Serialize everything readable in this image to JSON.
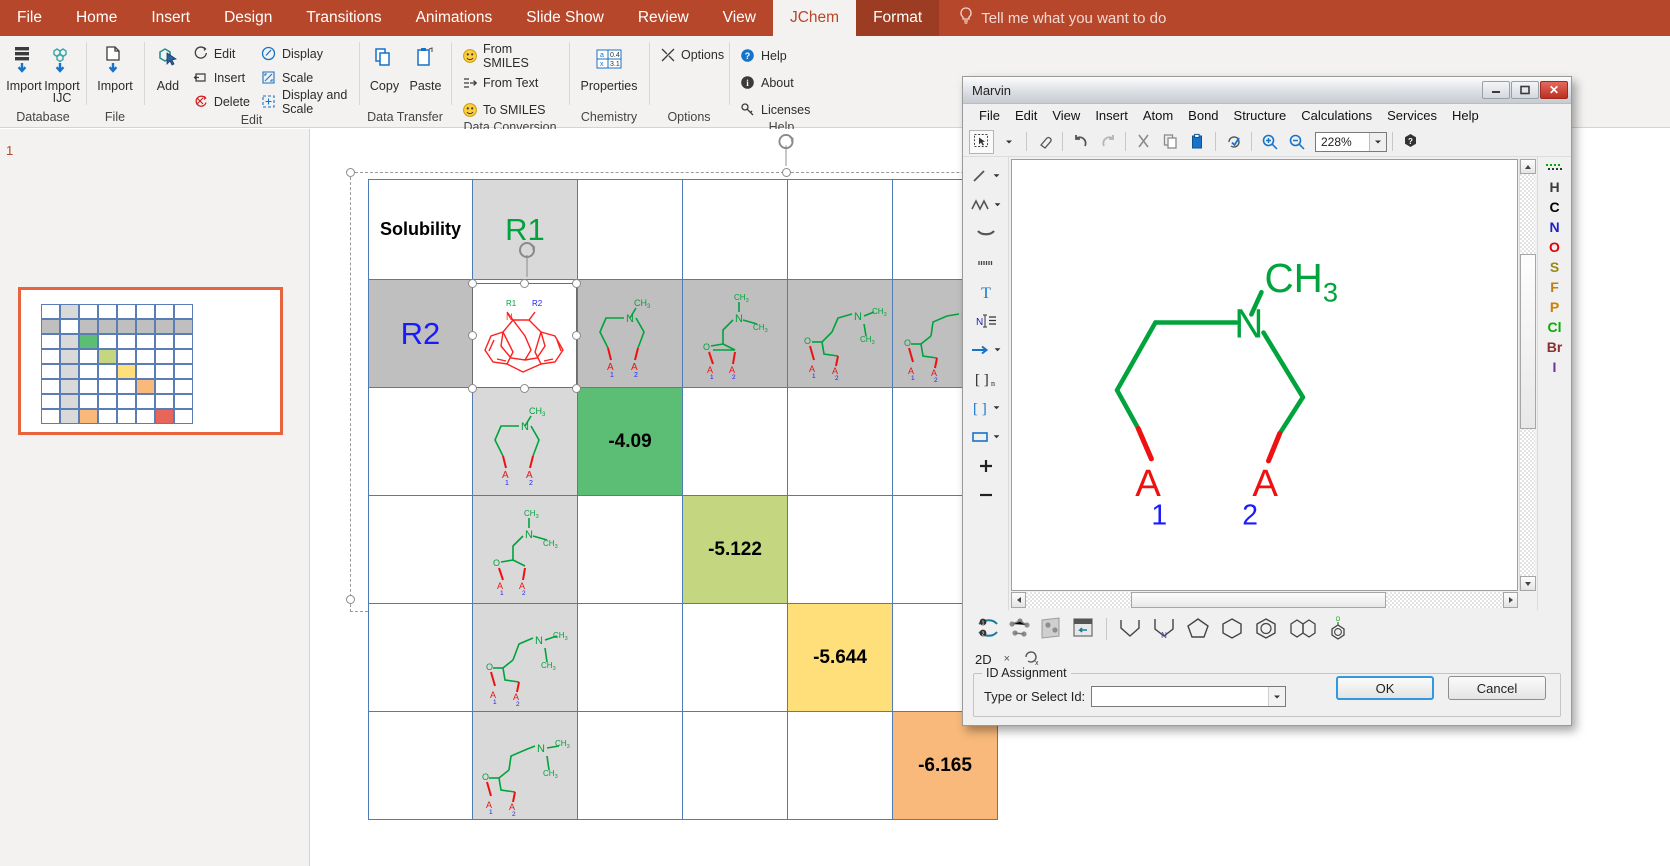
{
  "ribbon": {
    "tabs": [
      {
        "label": "File",
        "state": "normal"
      },
      {
        "label": "Home",
        "state": "normal"
      },
      {
        "label": "Insert",
        "state": "normal"
      },
      {
        "label": "Design",
        "state": "normal"
      },
      {
        "label": "Transitions",
        "state": "normal"
      },
      {
        "label": "Animations",
        "state": "normal"
      },
      {
        "label": "Slide Show",
        "state": "normal"
      },
      {
        "label": "Review",
        "state": "normal"
      },
      {
        "label": "View",
        "state": "normal"
      },
      {
        "label": "JChem",
        "state": "active"
      },
      {
        "label": "Format",
        "state": "context"
      }
    ],
    "tell_me": "Tell me what you want to do",
    "accent_color": "#b7472a",
    "groups": [
      {
        "name": "Database",
        "big_buttons": [
          {
            "label": "Import",
            "icon": "import-database-icon"
          },
          {
            "label": "Import IJC",
            "icon": "import-ijc-icon"
          }
        ],
        "small_buttons": []
      },
      {
        "name": "File",
        "big_buttons": [
          {
            "label": "Import",
            "icon": "import-file-icon"
          }
        ],
        "small_buttons": []
      },
      {
        "name": "Edit",
        "big_buttons": [
          {
            "label": "Add",
            "icon": "add-structure-icon"
          }
        ],
        "small_buttons": [
          {
            "label": "Edit",
            "icon": "edit-icon"
          },
          {
            "label": "Insert",
            "icon": "insert-icon"
          },
          {
            "label": "Delete",
            "icon": "delete-icon"
          },
          {
            "label": "Display",
            "icon": "display-icon"
          },
          {
            "label": "Scale",
            "icon": "scale-icon"
          },
          {
            "label": "Display and Scale",
            "icon": "display-and-scale-icon"
          }
        ]
      },
      {
        "name": "Data Transfer",
        "big_buttons": [
          {
            "label": "Copy",
            "icon": "copy-icon"
          },
          {
            "label": "Paste",
            "icon": "paste-icon"
          }
        ],
        "small_buttons": []
      },
      {
        "name": "Data Conversion",
        "big_buttons": [],
        "small_buttons": [
          {
            "label": "From SMILES",
            "icon": "from-smiles-icon"
          },
          {
            "label": "From Text",
            "icon": "from-text-icon"
          },
          {
            "label": "To SMILES",
            "icon": "to-smiles-icon"
          }
        ]
      },
      {
        "name": "Chemistry",
        "big_buttons": [
          {
            "label": "Properties",
            "icon": "properties-icon"
          }
        ],
        "small_buttons": []
      },
      {
        "name": "Options",
        "big_buttons": [],
        "small_buttons": [
          {
            "label": "Options",
            "icon": "options-icon"
          }
        ]
      },
      {
        "name": "Help",
        "big_buttons": [],
        "small_buttons": [
          {
            "label": "Help",
            "icon": "help-icon"
          },
          {
            "label": "About",
            "icon": "about-icon"
          },
          {
            "label": "Licenses",
            "icon": "licenses-icon"
          }
        ]
      }
    ]
  },
  "slide_panel": {
    "slide_number": "1"
  },
  "table": {
    "header_row": [
      {
        "text": "Solubility",
        "style": "label-solubility",
        "bg": "white"
      },
      {
        "text": "R1",
        "style": "label-r1",
        "bg": "grey-light"
      },
      {
        "text": "",
        "style": "empty",
        "bg": "white"
      },
      {
        "text": "",
        "style": "empty",
        "bg": "white"
      },
      {
        "text": "",
        "style": "empty",
        "bg": "white"
      },
      {
        "text": "",
        "style": "empty",
        "bg": "white"
      }
    ],
    "r2_row": [
      {
        "text": "R2",
        "style": "label-r2",
        "bg": "grey-dark"
      },
      {
        "text": "",
        "style": "scaffold",
        "bg": "white"
      },
      {
        "text": "",
        "style": "rgroup-a",
        "bg": "grey-dark"
      },
      {
        "text": "",
        "style": "rgroup-b",
        "bg": "grey-dark"
      },
      {
        "text": "",
        "style": "rgroup-c",
        "bg": "grey-dark"
      },
      {
        "text": "",
        "style": "rgroup-d",
        "bg": "grey-dark"
      }
    ],
    "data_rows": [
      {
        "rgroup": "rgroup-a",
        "col": 2,
        "value": "-4.09",
        "color": "#5cbd74"
      },
      {
        "rgroup": "rgroup-b",
        "col": 3,
        "value": "-5.122",
        "color": "#c4d780"
      },
      {
        "rgroup": "rgroup-c",
        "col": 4,
        "value": "-5.644",
        "color": "#ffdf7a"
      },
      {
        "rgroup": "rgroup-d",
        "col": 5,
        "value": "-6.165",
        "color": "#f8b97a"
      }
    ],
    "colors": {
      "grid": "#4f7cb5",
      "grey_light": "#d9d9d9",
      "grey_dark": "#bfbfbf",
      "r1_color": "#00a33c",
      "r2_color": "#1a1aff",
      "scaffold_color": "#ff2020",
      "rgroup_color": "#00a33c"
    }
  },
  "marvin": {
    "title": "Marvin",
    "window_buttons": [
      "minimize-button",
      "maximize-button",
      "close-button"
    ],
    "menu": [
      "File",
      "Edit",
      "View",
      "Insert",
      "Atom",
      "Bond",
      "Structure",
      "Calculations",
      "Services",
      "Help"
    ],
    "toolbar": {
      "items": [
        "select-tool",
        "eraser-tool",
        "undo-button",
        "redo-button",
        "cut-button",
        "copy-button",
        "paste-button",
        "clean-structure-button",
        "zoom-in-button",
        "zoom-out-button"
      ],
      "zoom_value": "228%",
      "help_label": "?"
    },
    "left_tools": [
      "single-bond-tool",
      "chain-tool",
      "arc-bond-tool",
      "hash-bond-tool",
      "text-tool",
      "atom-label-tool",
      "arrow-tool",
      "polymer-bracket-tool",
      "bracket-tool",
      "rectangle-tool",
      "plus-tool",
      "minus-tool"
    ],
    "elements": [
      "H",
      "C",
      "N",
      "O",
      "S",
      "F",
      "P",
      "Cl",
      "Br",
      "I"
    ],
    "element_colors": {
      "H": "#3c3c3c",
      "C": "#000000",
      "N": "#2020c0",
      "O": "#e00000",
      "S": "#9a8a10",
      "F": "#c08010",
      "P": "#d08000",
      "Cl": "#00b000",
      "Br": "#8a3030",
      "I": "#7030a0"
    },
    "bottom_tools": [
      "2d-clean-icon",
      "3d-clean-icon",
      "3d-view-icon",
      "import-template-icon",
      "cyclopentane-template",
      "pyrrole-template",
      "cyclopentadiene-template",
      "cyclohexane-template",
      "benzene-template",
      "naphthalene-template",
      "phenol-template"
    ],
    "view_mode": "2D",
    "id_assignment": {
      "group_label": "ID Assignment",
      "field_label": "Type or Select Id:",
      "value": "",
      "placeholder": ""
    },
    "buttons": {
      "ok": "OK",
      "cancel": "Cancel"
    },
    "structure": {
      "atom_labels": [
        "CH",
        "N",
        "A",
        "A"
      ],
      "methyl": "CH",
      "methyl_sub": "3",
      "nitrogen": "N",
      "attach_1_label": "A",
      "attach_1_index": "1",
      "attach_2_label": "A",
      "attach_2_index": "2",
      "bond_color_green": "#00a33c",
      "bond_color_red": "#ee1111",
      "index_color": "#1a1aff"
    }
  }
}
